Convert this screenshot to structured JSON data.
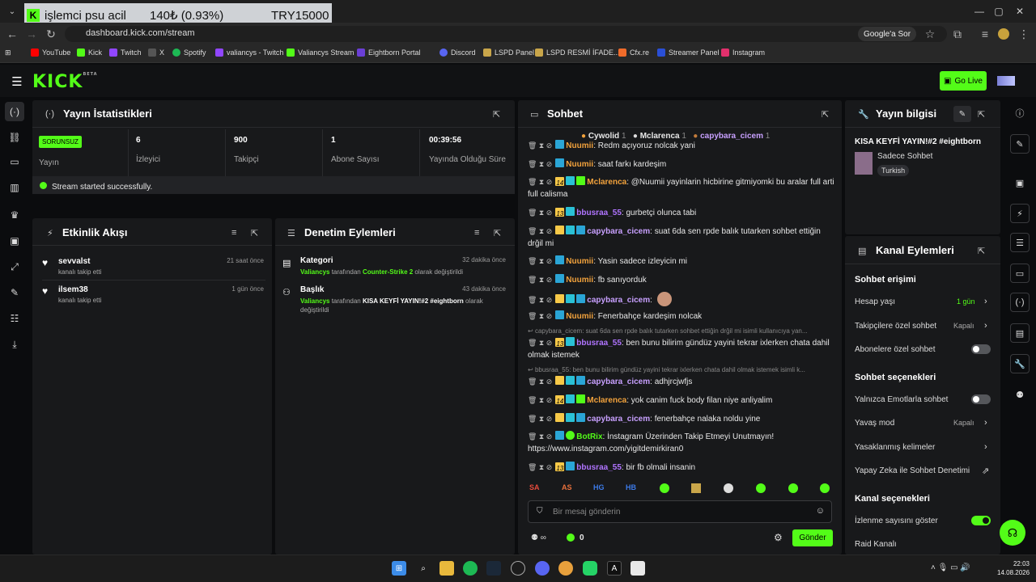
{
  "browser": {
    "donation": {
      "text": "işlemci psu acil",
      "amount": "140₺ (0.93%)",
      "goal": "TRY15000"
    },
    "url": "dashboard.kick.com/stream",
    "google_btn": "Google'a Sor",
    "bookmarks": [
      "YouTube",
      "Kick",
      "Twitch",
      "X",
      "Spotify",
      "valiancys - Twitch",
      "Valiancys Stream",
      "Eightborn Portal",
      "Discord",
      "LSPD Panel",
      "LSPD  RESMİ İFADE...",
      "Cfx.re",
      "Streamer Panel",
      "Instagram"
    ]
  },
  "header": {
    "logo": "KICK",
    "beta": "BETA",
    "go_live": "Go Live"
  },
  "stats": {
    "title": "Yayın İstatistikleri",
    "status_badge": "SORUNSUZ",
    "status_label": "Yayın",
    "viewers": "6",
    "viewers_label": "İzleyici",
    "followers": "900",
    "followers_label": "Takipçi",
    "subs": "1",
    "subs_label": "Abone Sayısı",
    "uptime": "00:39:56",
    "uptime_label": "Yayında Olduğu Süre",
    "success": "Stream started successfully."
  },
  "activity": {
    "title": "Etkinlik Akışı",
    "items": [
      {
        "name": "sevvalst",
        "desc": "kanalı takip etti",
        "time": "21 saat önce"
      },
      {
        "name": "ilsem38",
        "desc": "kanalı takip etti",
        "time": "1 gün önce"
      }
    ]
  },
  "moderation": {
    "title": "Denetim Eylemleri",
    "items": [
      {
        "title": "Kategori",
        "time": "32 dakika önce",
        "actor": "Valiancys",
        "mid": " tarafından ",
        "target": "Counter-Strike 2",
        "tail": " olarak değiştirildi"
      },
      {
        "title": "Başlık",
        "time": "43 dakika önce",
        "actor": "Valiancys",
        "mid": " tarafından ",
        "target": "KISA KEYFİ YAYIN!#2 #eightborn",
        "tail": " olarak değiştirildi"
      }
    ]
  },
  "chat": {
    "title": "Sohbet",
    "top_gifters": [
      {
        "name": "Cywolid",
        "count": "1"
      },
      {
        "name": "Mclarenca",
        "count": "1"
      },
      {
        "name": "capybara_cicem",
        "count": "1"
      }
    ],
    "messages": [
      {
        "user": "Nuumii",
        "text": "Redm açıyoruz nolcak yani"
      },
      {
        "user": "Nuumii",
        "text": "saat farkı kardeşim"
      },
      {
        "user": "Mclarenca",
        "badge": "14",
        "text": "@Nuumii yayinlarin hicbirine gitmiyomki bu aralar full arti full calisma"
      },
      {
        "user": "bbusraa_55",
        "badge": "13",
        "text": "gurbetçi olunca tabi"
      },
      {
        "user": "capybara_cicem",
        "text": "suat 6da sen rpde balık tutarken sohbet ettiğin drğil mi"
      },
      {
        "user": "Nuumii",
        "text": "Yasin sadece izleyicin mi"
      },
      {
        "user": "Nuumii",
        "text": "fb sanıyorduk"
      },
      {
        "user": "capybara_cicem",
        "text": ""
      },
      {
        "user": "Nuumii",
        "text": "Fenerbahçe kardeşim nolcak"
      },
      {
        "reply": "capybara_cicem: suat 6da sen rpde balık tutarken sohbet ettiğin drğil mi isimli kullanıcıya yan..."
      },
      {
        "user": "bbusraa_55",
        "badge": "13",
        "text": "ben bunu bilirim gündüz yayini tekrar ixlerken chata dahil olmak istemek"
      },
      {
        "reply": "bbusraa_55: ben bunu bilirim gündüz yayini tekrar ixlerken chata dahil olmak istemek isimli k..."
      },
      {
        "user": "capybara_cicem",
        "text": "adhjrcjwfjs"
      },
      {
        "user": "Mclarenca",
        "badge": "14",
        "text": "yok canim fuck body filan niye anliyalim"
      },
      {
        "user": "capybara_cicem",
        "text": "fenerbahçe nalaka noldu yine"
      },
      {
        "user": "BotRix",
        "text": "İnstagram Üzerinden Takip Etmeyi Unutmayın! https://www.instagram.com/yigitdemirkiran0"
      },
      {
        "user": "bbusraa_55",
        "badge": "13",
        "text": "bir fb olmali insanin"
      }
    ],
    "emotes": [
      "SA",
      "AS",
      "HG",
      "HB"
    ],
    "input_placeholder": "Bir mesaj gönderin",
    "points": "0",
    "send": "Gönder"
  },
  "stream_info": {
    "title": "Yayın bilgisi",
    "stream_title": "KISA KEYFİ YAYIN!#2 #eightborn",
    "mode": "Sadece Sohbet",
    "language": "Turkish"
  },
  "channel_actions": {
    "title": "Kanal Eylemleri",
    "chat_access": "Sohbet erişimi",
    "account_age": "Hesap yaşı",
    "account_age_val": "1 gün",
    "followers_only": "Takipçilere özel sohbet",
    "followers_only_val": "Kapalı",
    "subs_only": "Abonelere özel sohbet",
    "chat_options": "Sohbet seçenekleri",
    "emote_only": "Yalnızca Emotlarla sohbet",
    "slow_mode": "Yavaş mod",
    "slow_mode_val": "Kapalı",
    "banned_words": "Yasaklanmış kelimeler",
    "ai_mod": "Yapay Zeka ile Sohbet Denetimi",
    "channel_options": "Kanal seçenekleri",
    "show_views": "İzlenme sayısını göster",
    "raid": "Raid Kanalı"
  },
  "taskbar": {
    "time": "22:03",
    "date": "14.08.2026"
  }
}
